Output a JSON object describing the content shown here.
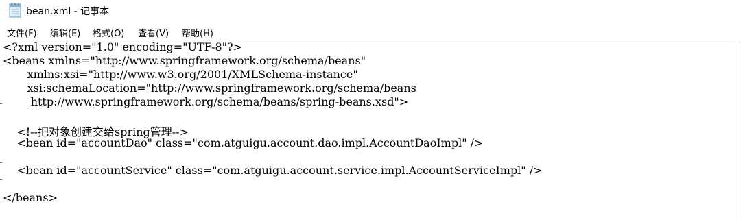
{
  "window": {
    "title": "bean.xml - 记事本"
  },
  "menu": [
    {
      "label": "文件(F)"
    },
    {
      "label": "编辑(E)"
    },
    {
      "label": "格式(O)"
    },
    {
      "label": "查看(V)"
    },
    {
      "label": "帮助(H)"
    }
  ],
  "editor": {
    "lines": [
      "<?xml version=\"1.0\" encoding=\"UTF-8\"?>",
      "<beans xmlns=\"http://www.springframework.org/schema/beans\"",
      "       xmlns:xsi=\"http://www.w3.org/2001/XMLSchema-instance\"",
      "       xsi:schemaLocation=\"http://www.springframework.org/schema/beans",
      "        http://www.springframework.org/schema/beans/spring-beans.xsd\">",
      "",
      "    <!--把对象创建交给spring管理-->",
      "    <bean id=\"accountDao\" class=\"com.atguigu.account.dao.impl.AccountDaoImpl\" />",
      "",
      "    <bean id=\"accountService\" class=\"com.atguigu.account.service.impl.AccountServiceImpl\" />",
      "",
      "</beans>"
    ]
  }
}
